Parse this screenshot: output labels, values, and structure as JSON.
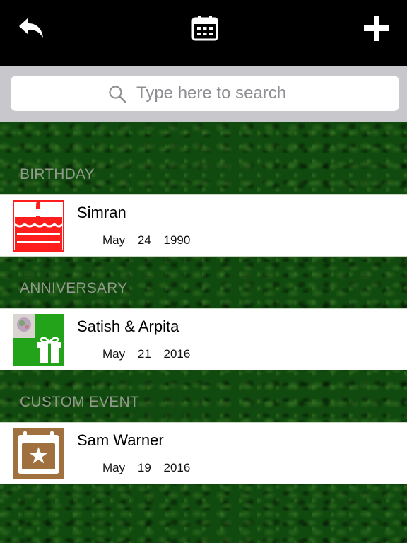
{
  "toolbar": {
    "back_icon": "back-arrow-icon",
    "calendar_icon": "calendar-icon",
    "add_icon": "plus-icon"
  },
  "search": {
    "placeholder": "Type here to search",
    "value": ""
  },
  "sections": [
    {
      "header": "BIRTHDAY",
      "items": [
        {
          "name": "Simran",
          "month": "May",
          "day": "24",
          "year": "1990",
          "icon": "birthday-cake-icon",
          "color": "#ff1e1e"
        }
      ]
    },
    {
      "header": "ANNIVERSARY",
      "items": [
        {
          "name": "Satish & Arpita",
          "month": "May",
          "day": "21",
          "year": "2016",
          "icon": "gift-icon",
          "color": "#22a31a"
        }
      ]
    },
    {
      "header": "CUSTOM EVENT",
      "items": [
        {
          "name": "Sam Warner",
          "month": "May",
          "day": "19",
          "year": "2016",
          "icon": "calendar-star-icon",
          "color": "#a0703e"
        }
      ]
    }
  ]
}
